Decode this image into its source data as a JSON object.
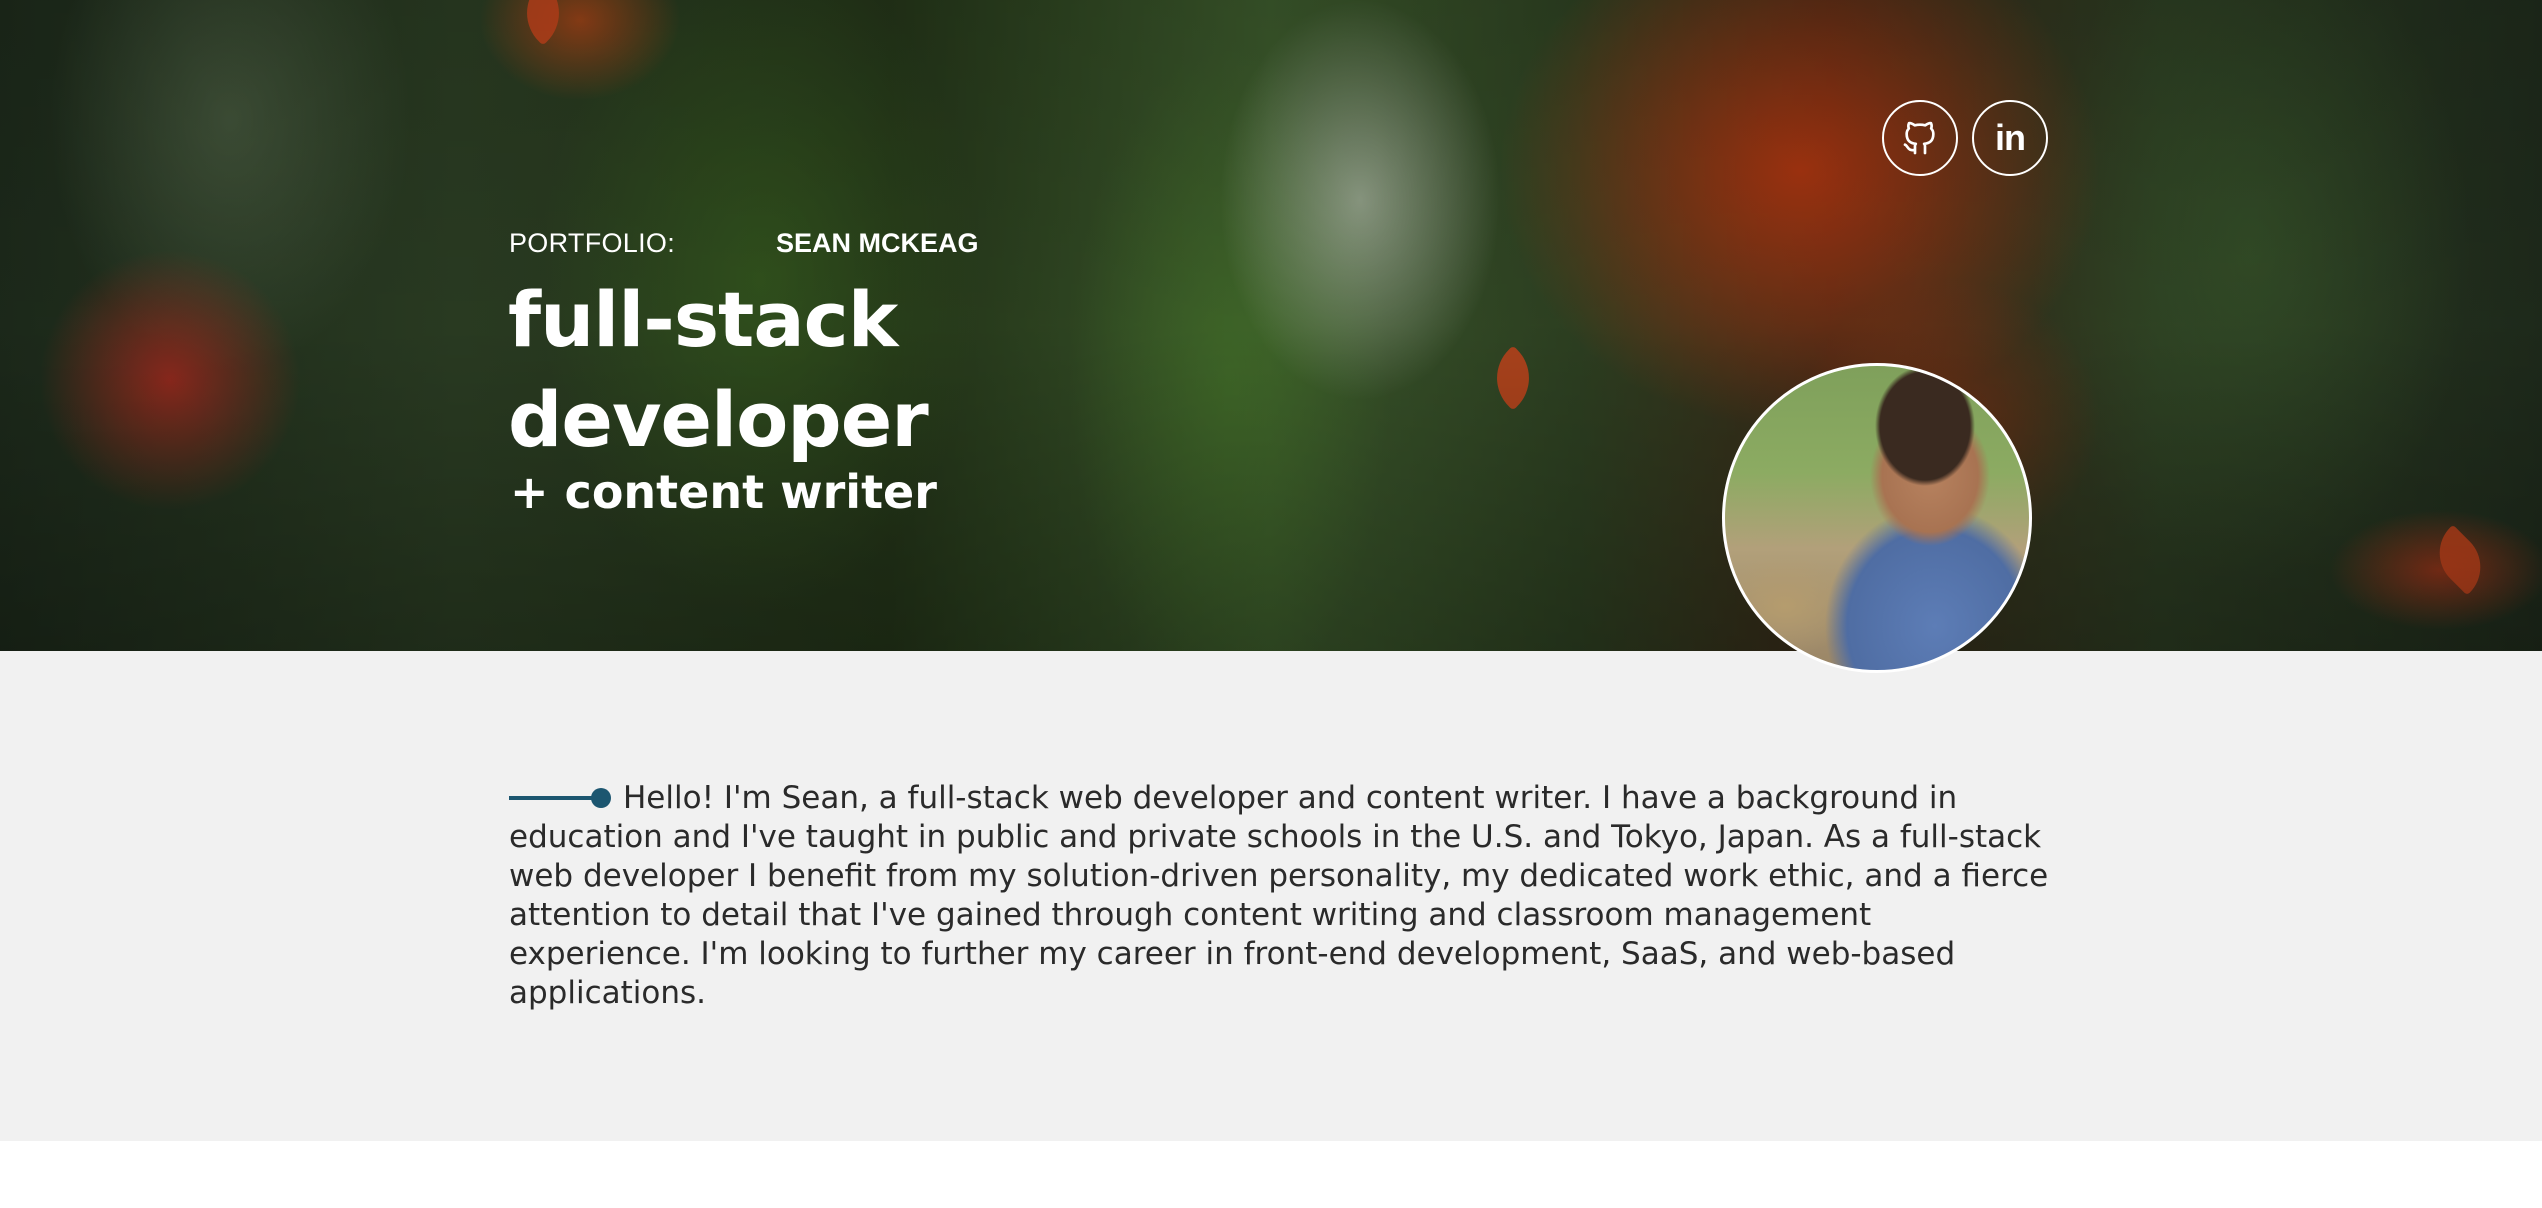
{
  "header": {
    "portfolio_label": "PORTFOLIO:",
    "owner_name": "SEAN MCKEAG",
    "title": "full-stack developer",
    "subtitle": "+ content writer"
  },
  "social": {
    "github_icon": "github-icon",
    "linkedin_label": "in"
  },
  "about": {
    "text": "Hello! I'm Sean, a full-stack web developer and content writer. I have a background in education and I've taught in public and private schools in the U.S. and Tokyo, Japan. As a full-stack web developer I benefit from my solution-driven personality, my dedicated work ethic, and a fierce attention to detail that I've gained through content writing and classroom management experience. I'm looking to further my career in front-end development, SaaS, and web-based applications."
  },
  "colors": {
    "accent": "#1c5670",
    "section_bg": "#f1f1f1"
  }
}
